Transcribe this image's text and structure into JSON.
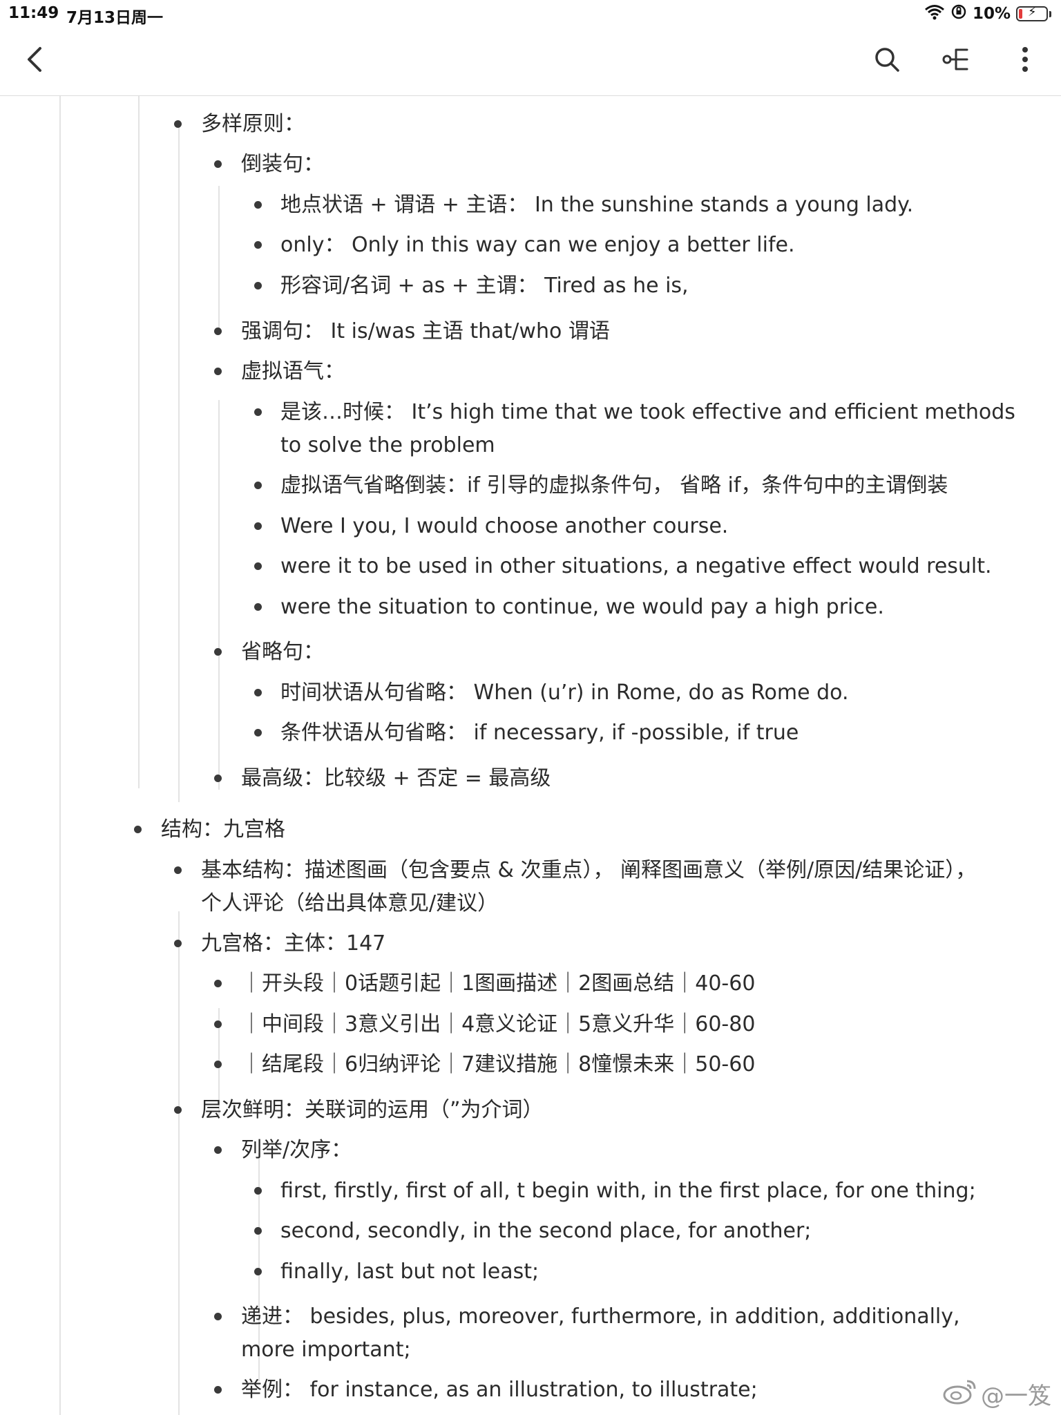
{
  "status_bar": {
    "time": "11:49",
    "date": "7月13日周一",
    "battery": "10%"
  },
  "nav": {
    "back_icon": "chevron-left-icon",
    "search_icon": "search-icon",
    "mindmap_icon": "mindmap-icon",
    "more_icon": "more-vertical-icon"
  },
  "outline": [
    {
      "level": 2,
      "text": "多样原则："
    },
    {
      "level": 3,
      "text": "倒装句："
    },
    {
      "level": 4,
      "text": "地点状语 + 谓语 + 主语： In the sunshine stands a young lady."
    },
    {
      "level": 4,
      "text": "only： Only in this way can we enjoy a better life."
    },
    {
      "level": 4,
      "text": "形容词/名词 + as + 主谓： Tired as he is,"
    },
    {
      "level": 3,
      "text": "强调句： It is/was 主语 that/who 谓语"
    },
    {
      "level": 3,
      "text": "虚拟语气："
    },
    {
      "level": 4,
      "text": "是该…时候： It’s high time that we took effective and efficient methods to solve the problem"
    },
    {
      "level": 4,
      "text": "虚拟语气省略倒装：if 引导的虚拟条件句， 省略 if，条件句中的主谓倒装"
    },
    {
      "level": 4,
      "text": "Were I you, I would choose another course."
    },
    {
      "level": 4,
      "text": "were it to be used in other situations, a negative effect would result."
    },
    {
      "level": 4,
      "text": "were the situation to continue, we would pay a high price."
    },
    {
      "level": 3,
      "text": "省略句："
    },
    {
      "level": 4,
      "text": "时间状语从句省略： When (u’r) in Rome, do as Rome do."
    },
    {
      "level": 4,
      "text": "条件状语从句省略： if necessary, if -possible, if true"
    },
    {
      "level": 3,
      "text": "最高级：比较级 + 否定 = 最高级"
    },
    {
      "level": 1,
      "text": "结构：九宫格"
    },
    {
      "level": 2,
      "text": "基本结构：描述图画（包含要点 & 次重点）， 阐释图画意义（举例/原因/结果论证）， 个人评论（给出具体意见/建议）"
    },
    {
      "level": 2,
      "text": "九宫格：主体：147"
    },
    {
      "level": 3,
      "text": "｜开头段｜0话题引起｜1图画描述｜2图画总结｜40-60"
    },
    {
      "level": 3,
      "text": "｜中间段｜3意义引出｜4意义论证｜5意义升华｜60-80"
    },
    {
      "level": 3,
      "text": "｜结尾段｜6归纳评论｜7建议措施｜8憧憬未来｜50-60"
    },
    {
      "level": 2,
      "text": "层次鲜明：关联词的运用（”为介词）"
    },
    {
      "level": 3,
      "text": "列举/次序："
    },
    {
      "level": 4,
      "text": "first, firstly, first of all, t begin with, in the first place, for one thing;"
    },
    {
      "level": 4,
      "text": "second, secondly, in the second place, for another;"
    },
    {
      "level": 4,
      "text": "finally, last but not least;"
    },
    {
      "level": 3,
      "text": "递进： besides, plus, moreover, furthermore, in addition, additionally, more important;"
    },
    {
      "level": 3,
      "text": "举例： for instance, as an illustration, to illustrate;"
    }
  ],
  "watermark": {
    "icon": "weibo-icon",
    "text": "@一笈"
  }
}
